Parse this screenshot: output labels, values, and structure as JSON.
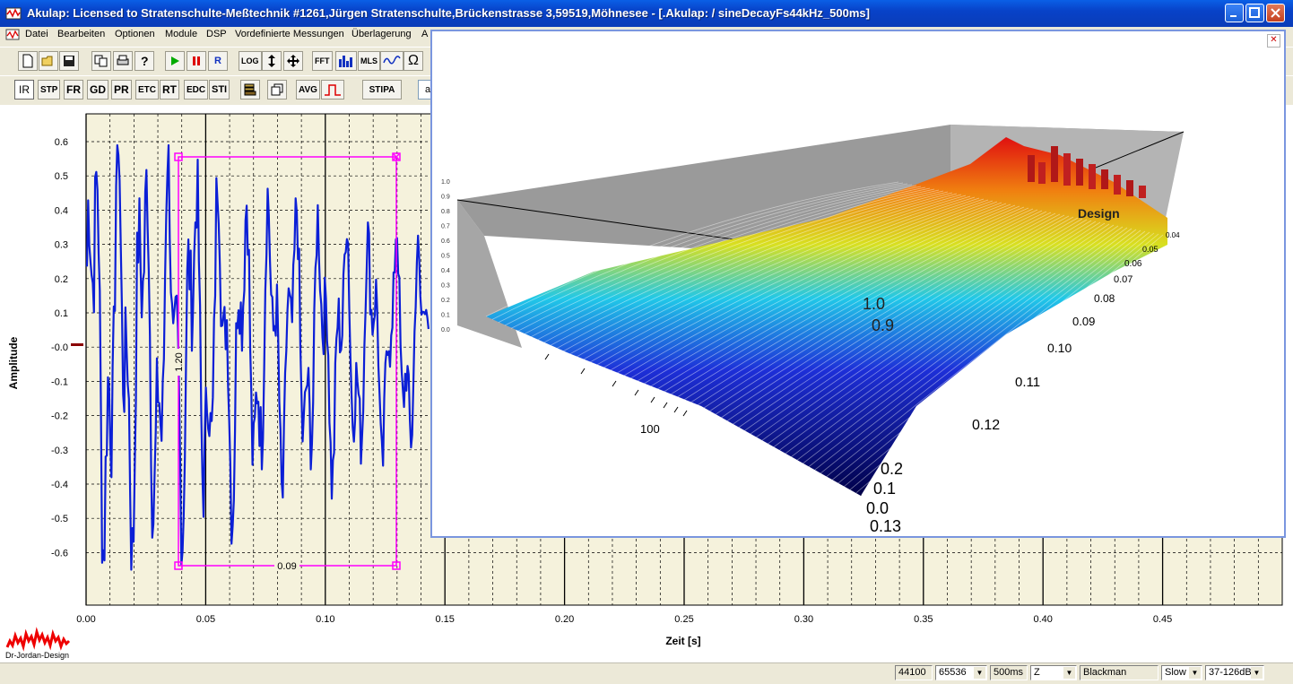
{
  "window": {
    "title": "Akulap: Licensed to Stratenschulte-Meßtechnik #1261,Jürgen Stratenschulte,Brückenstrasse 3,59519,Möhnesee - [.Akulap: / sineDecayFs44kHz_500ms]"
  },
  "menu": [
    "Datei",
    "Bearbeiten",
    "Optionen",
    "Module",
    "DSP",
    "Vordefinierte Messungen",
    "Überlagerung",
    "A"
  ],
  "toolbar1": {
    "log": "LOG",
    "fft": "FFT",
    "mls": "MLS",
    "ohm": "Ω",
    "run": "R"
  },
  "toolbar2": [
    "IR",
    "STP",
    "FR",
    "GD",
    "PR",
    "ETC",
    "RT",
    "EDC",
    "STI",
    "AVG",
    "STIPA"
  ],
  "toolbar2_input": "a",
  "plot": {
    "ylabel": "Amplitude",
    "xlabel": "Zeit [s]",
    "yticks": [
      "0.6",
      "0.5",
      "0.4",
      "0.3",
      "0.2",
      "0.1",
      "-0.0",
      "-0.1",
      "-0.2",
      "-0.3",
      "-0.4",
      "-0.5",
      "-0.6"
    ],
    "xticks": [
      "0.00",
      "0.05",
      "0.10",
      "0.15",
      "0.20",
      "0.25",
      "0.30",
      "0.35",
      "0.40",
      "0.45"
    ],
    "selection_width": "0.09",
    "selection_height": "1.20",
    "logo": "Dr-Jordan-Design",
    "colors": {
      "trace": "#0b1fd6",
      "background": "#f5f2dc",
      "selection": "#ff00ff"
    }
  },
  "waterfall": {
    "time_ticks": [
      "0.04",
      "0.05",
      "0.06",
      "0.07",
      "0.08",
      "0.09",
      "0.10",
      "0.11",
      "0.12",
      "0.13"
    ],
    "freq_label": "100",
    "amp_ticks": [
      "1.0",
      "0.9",
      "0.8",
      "0.7",
      "0.6",
      "0.5",
      "0.4",
      "0.3",
      "0.2",
      "0.1",
      "0.0"
    ],
    "front_ticks": [
      "0.2",
      "0.1",
      "0.0"
    ],
    "depth_labels": [
      "1.0",
      "0.9"
    ],
    "watermark": "Design"
  },
  "statusbar": {
    "samplerate": "44100",
    "fftsize": "65536",
    "duration": "500ms",
    "weighting": "Z",
    "window": "Blackman",
    "speed": "Slow",
    "range": "37-126dB"
  }
}
